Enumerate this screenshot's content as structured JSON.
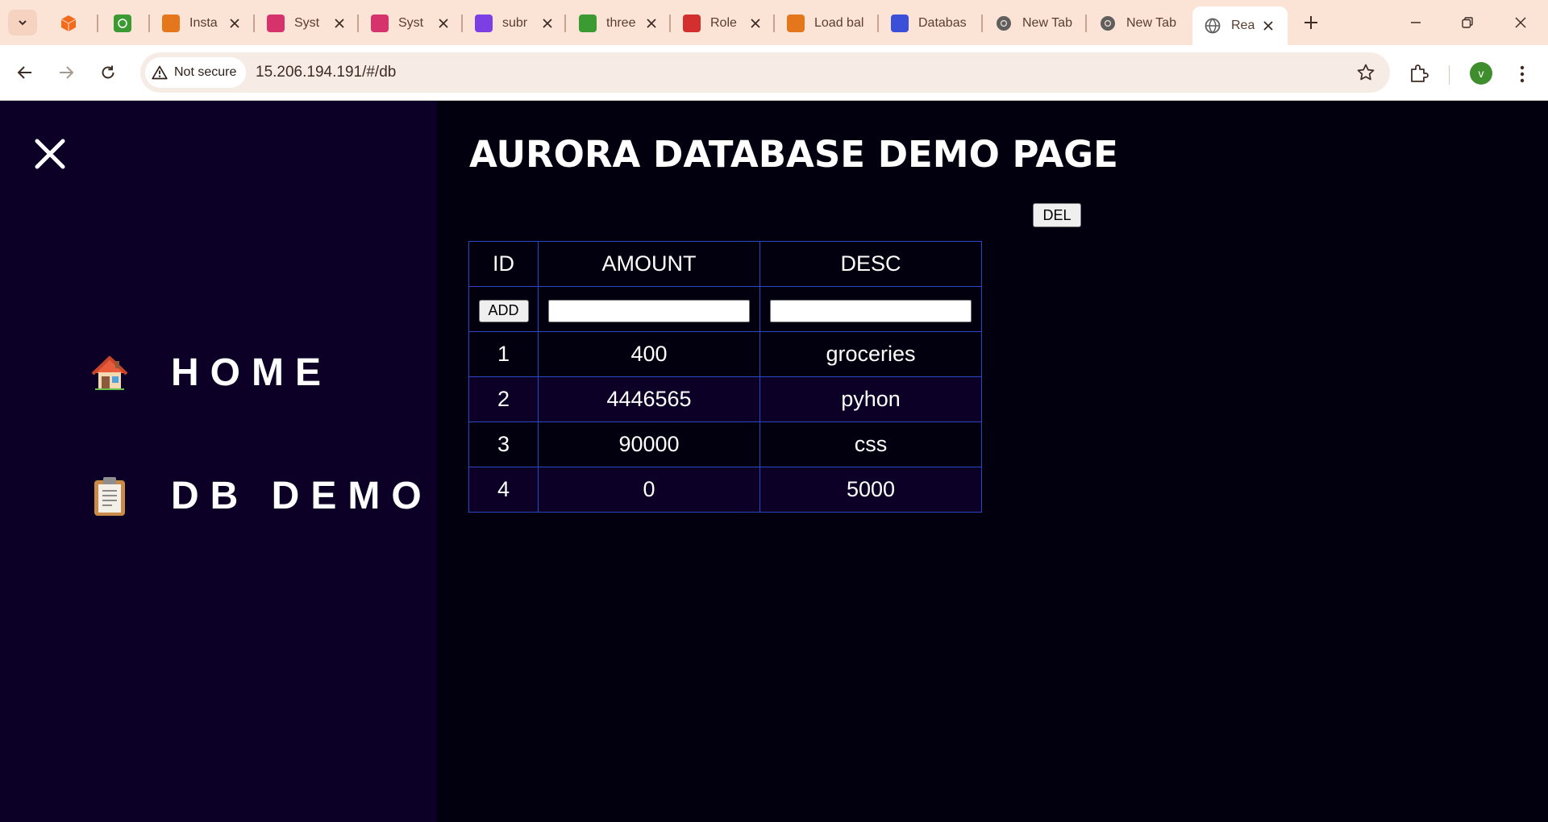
{
  "browser": {
    "tabs": [
      {
        "title": "",
        "color": "#f26b1d"
      },
      {
        "title": "",
        "color": "#3b9b32"
      },
      {
        "title": "Insta",
        "color": "#e4761b"
      },
      {
        "title": "Syst",
        "color": "#d6336c"
      },
      {
        "title": "Syst",
        "color": "#d6336c"
      },
      {
        "title": "subr",
        "color": "#7b3fe4"
      },
      {
        "title": "three",
        "color": "#3b9b32"
      },
      {
        "title": "Role",
        "color": "#d32f2f"
      },
      {
        "title": "Load bal",
        "color": "#e4761b"
      },
      {
        "title": "Databas",
        "color": "#3b4fd8"
      },
      {
        "title": "New Tab",
        "color": "#5f5f5f"
      },
      {
        "title": "New Tab",
        "color": "#5f5f5f"
      },
      {
        "title": "Rea",
        "color": "#5f5f5f"
      }
    ],
    "security_label": "Not secure",
    "url": "15.206.194.191/#/db",
    "profile_initial": "v"
  },
  "sidebar": {
    "items": [
      {
        "label": "HOME",
        "icon": "house-icon"
      },
      {
        "label": "DB DEMO",
        "icon": "clipboard-icon"
      }
    ]
  },
  "main": {
    "title": "AURORA DATABASE DEMO PAGE",
    "del_label": "DEL",
    "add_label": "ADD",
    "columns": [
      "ID",
      "AMOUNT",
      "DESC"
    ],
    "rows": [
      {
        "id": "1",
        "amount": "400",
        "desc": "groceries"
      },
      {
        "id": "2",
        "amount": "4446565",
        "desc": "pyhon"
      },
      {
        "id": "3",
        "amount": "90000",
        "desc": "css"
      },
      {
        "id": "4",
        "amount": "0",
        "desc": "5000"
      }
    ]
  }
}
